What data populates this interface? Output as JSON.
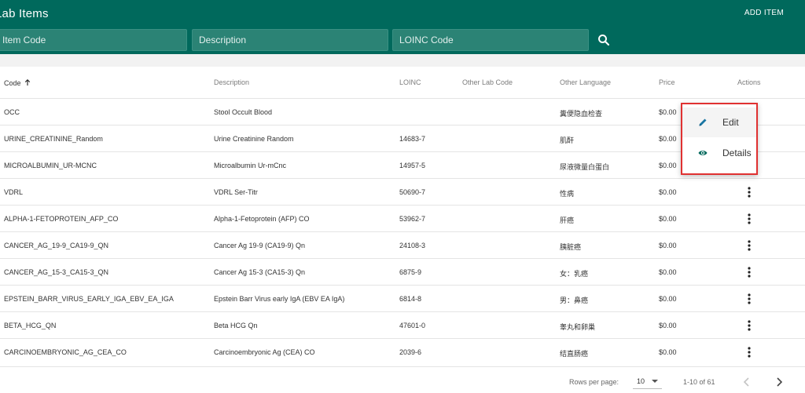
{
  "header": {
    "title": "Lab Items",
    "add_item_label": "ADD ITEM"
  },
  "filters": {
    "item_code_placeholder": "Item Code",
    "description_placeholder": "Description",
    "loinc_placeholder": "LOINC Code"
  },
  "table": {
    "columns": {
      "code": "Code",
      "description": "Description",
      "loinc": "LOINC",
      "other_lab_code": "Other Lab Code",
      "other_language": "Other Language",
      "price": "Price",
      "actions": "Actions"
    },
    "rows": [
      {
        "code": "OCC",
        "description": "Stool Occult Blood",
        "loinc": "",
        "other_lab_code": "",
        "other_language": "糞便隐血检查",
        "price": "$0.00"
      },
      {
        "code": "URINE_CREATININE_Random",
        "description": "Urine Creatinine Random",
        "loinc": "14683-7",
        "other_lab_code": "",
        "other_language": "肌酐",
        "price": "$0.00"
      },
      {
        "code": "MICROALBUMIN_UR-MCNC",
        "description": "Microalbumin Ur-mCnc",
        "loinc": "14957-5",
        "other_lab_code": "",
        "other_language": "尿液微量白蛋白",
        "price": "$0.00"
      },
      {
        "code": "VDRL",
        "description": "VDRL Ser-Titr",
        "loinc": "50690-7",
        "other_lab_code": "",
        "other_language": "性病",
        "price": "$0.00"
      },
      {
        "code": "ALPHA-1-FETOPROTEIN_AFP_CO",
        "description": "Alpha-1-Fetoprotein (AFP) CO",
        "loinc": "53962-7",
        "other_lab_code": "",
        "other_language": "肝癌",
        "price": "$0.00"
      },
      {
        "code": "CANCER_AG_19-9_CA19-9_QN",
        "description": "Cancer Ag 19-9 (CA19-9) Qn",
        "loinc": "24108-3",
        "other_lab_code": "",
        "other_language": "胰脏癌",
        "price": "$0.00"
      },
      {
        "code": "CANCER_AG_15-3_CA15-3_QN",
        "description": "Cancer Ag 15-3 (CA15-3) Qn",
        "loinc": "6875-9",
        "other_lab_code": "",
        "other_language": "女：乳癌",
        "price": "$0.00"
      },
      {
        "code": "EPSTEIN_BARR_VIRUS_EARLY_IGA_EBV_EA_IGA",
        "description": "Epstein Barr Virus early IgA (EBV EA IgA)",
        "loinc": "6814-8",
        "other_lab_code": "",
        "other_language": "男：鼻癌",
        "price": "$0.00"
      },
      {
        "code": "BETA_HCG_QN",
        "description": "Beta HCG Qn",
        "loinc": "47601-0",
        "other_lab_code": "",
        "other_language": "睾丸和卵巢",
        "price": "$0.00"
      },
      {
        "code": "CARCINOEMBRYONIC_AG_CEA_CO",
        "description": "Carcinoembryonic Ag (CEA) CO",
        "loinc": "2039-6",
        "other_lab_code": "",
        "other_language": "结直肠癌",
        "price": "$0.00"
      }
    ]
  },
  "actions_menu": {
    "edit_label": "Edit",
    "details_label": "Details"
  },
  "pagination": {
    "rows_per_page_label": "Rows per page:",
    "rows_per_page_value": "10",
    "range_label": "1-10 of 61"
  },
  "colors": {
    "header": "#00695c",
    "menu_highlight_border": "#e03131",
    "icon_accent": "#1976a3",
    "eye_icon": "#00695c"
  },
  "icons": {
    "sort": "arrow-up-icon",
    "search": "search-icon",
    "row_action": "more-vert-icon",
    "edit": "pencil-icon",
    "details": "eye-icon",
    "prev": "chevron-left-icon",
    "next": "chevron-right-icon"
  }
}
